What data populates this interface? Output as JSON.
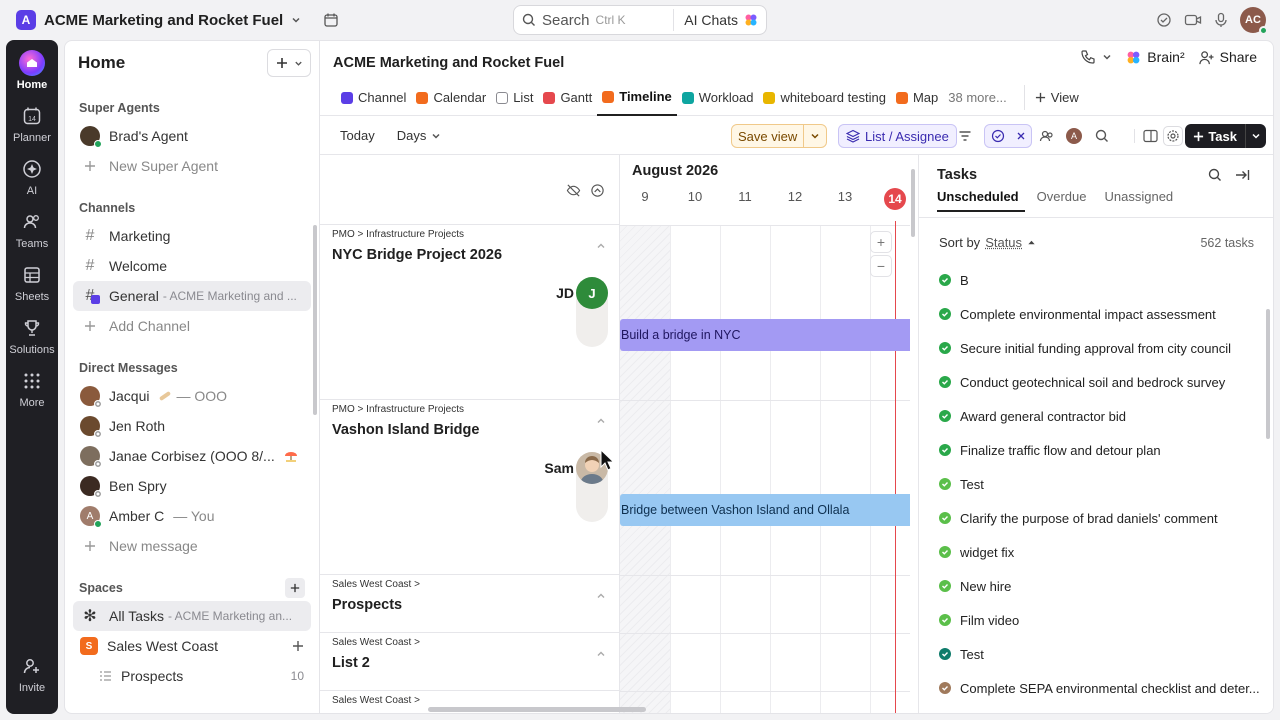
{
  "workspace": {
    "name": "ACME Marketing and Rocket Fuel",
    "initial": "A",
    "color": "#5b3ee6"
  },
  "search": {
    "placeholder": "Search",
    "shortcut": "Ctrl K",
    "ai_label": "AI Chats"
  },
  "user": {
    "initials": "AC"
  },
  "rail": {
    "items": [
      {
        "label": "Home",
        "icon": "home-icon"
      },
      {
        "label": "Planner",
        "icon": "calendar-icon"
      },
      {
        "label": "AI",
        "icon": "ai-icon"
      },
      {
        "label": "Teams",
        "icon": "teams-icon"
      },
      {
        "label": "Sheets",
        "icon": "sheets-icon"
      },
      {
        "label": "Solutions",
        "icon": "trophy-icon"
      },
      {
        "label": "More",
        "icon": "grid-icon"
      }
    ],
    "invite": "Invite"
  },
  "sidebar": {
    "title": "Home",
    "super_agents": {
      "header": "Super Agents",
      "agent": "Brad's Agent",
      "new": "New Super Agent"
    },
    "channels": {
      "header": "Channels",
      "items": [
        {
          "label": "Marketing",
          "suffix": ""
        },
        {
          "label": "Welcome",
          "suffix": ""
        },
        {
          "label": "General",
          "suffix": "- ACME Marketing and ..."
        }
      ],
      "add": "Add Channel"
    },
    "dms": {
      "header": "Direct Messages",
      "items": [
        {
          "label": "Jacqui",
          "suffix": "— OOO",
          "color": "#8a5a3c"
        },
        {
          "label": "Jen Roth",
          "suffix": "",
          "color": "#6b4a2e"
        },
        {
          "label": "Janae Corbisez (OOO 8/...",
          "suffix": "",
          "color": "#7d6e5e"
        },
        {
          "label": "Ben Spry",
          "suffix": "",
          "color": "#3b2a22"
        },
        {
          "label": "Amber C",
          "suffix": "— You",
          "color": "#a07c6b"
        }
      ],
      "new": "New message"
    },
    "spaces": {
      "header": "Spaces",
      "all_tasks": "All Tasks",
      "all_tasks_suffix": "- ACME Marketing an...",
      "space": "Sales West Coast",
      "sub": "Prospects",
      "sub_count": "10"
    }
  },
  "main": {
    "title": "ACME Marketing and Rocket Fuel",
    "brain": "Brain²",
    "share": "Share",
    "tabs": [
      {
        "label": "Channel",
        "color": "#5b3ee6"
      },
      {
        "label": "Calendar",
        "color": "#f26b1d"
      },
      {
        "label": "List",
        "color": "#8a8a90"
      },
      {
        "label": "Gantt",
        "color": "#e5484d"
      },
      {
        "label": "Timeline",
        "color": "#f26b1d"
      },
      {
        "label": "Workload",
        "color": "#0ea5a0"
      },
      {
        "label": "whiteboard testing",
        "color": "#e8b600"
      },
      {
        "label": "Map",
        "color": "#f26b1d"
      }
    ],
    "more_tabs": "38 more...",
    "add_view": "View",
    "toolbar": {
      "today": "Today",
      "days": "Days",
      "save_view": "Save view",
      "group": "List / Assignee",
      "task": "Task"
    }
  },
  "timeline": {
    "month": "August 2026",
    "days": [
      "9",
      "10",
      "11",
      "12",
      "13",
      "14"
    ],
    "today": "14",
    "groups": [
      {
        "path": "PMO > Infrastructure Projects",
        "name": "NYC Bridge Project 2026",
        "assignee": "JD",
        "avatar_letter": "J",
        "avatar_color": "#2e8b3a",
        "bar": "Build a bridge in NYC",
        "bar_color": "#a39af3"
      },
      {
        "path": "PMO > Infrastructure Projects",
        "name": "Vashon Island Bridge",
        "assignee": "Sam",
        "avatar_letter": "",
        "avatar_color": "#c9b9a6",
        "bar": "Bridge between Vashon Island and Ollala",
        "bar_color": "#98c8f2"
      },
      {
        "path": "Sales West Coast >",
        "name": "Prospects"
      },
      {
        "path": "Sales West Coast >",
        "name": "List 2"
      },
      {
        "path": "Sales West Coast >",
        "name": ""
      }
    ]
  },
  "tasks_panel": {
    "title": "Tasks",
    "tabs": [
      "Unscheduled",
      "Overdue",
      "Unassigned"
    ],
    "sort_label": "Sort by",
    "sort_field": "Status",
    "count": "562 tasks",
    "items": [
      {
        "label": "B",
        "color": "#2aa84a"
      },
      {
        "label": "Complete environmental impact assessment",
        "color": "#2aa84a"
      },
      {
        "label": "Secure initial funding approval from city council",
        "color": "#2aa84a"
      },
      {
        "label": "Conduct geotechnical soil and bedrock survey",
        "color": "#2aa84a"
      },
      {
        "label": "Award general contractor bid",
        "color": "#2aa84a"
      },
      {
        "label": "Finalize traffic flow and detour plan",
        "color": "#2aa84a"
      },
      {
        "label": "Test",
        "color": "#5bbf4a"
      },
      {
        "label": "Clarify the purpose of brad daniels' comment",
        "color": "#5bbf4a"
      },
      {
        "label": "widget fix",
        "color": "#5bbf4a"
      },
      {
        "label": "New hire",
        "color": "#5bbf4a"
      },
      {
        "label": "Film video",
        "color": "#5bbf4a"
      },
      {
        "label": "Test",
        "color": "#0f7c6b"
      },
      {
        "label": "Complete SEPA environmental checklist and deter...",
        "color": "#a07a5c"
      }
    ]
  }
}
